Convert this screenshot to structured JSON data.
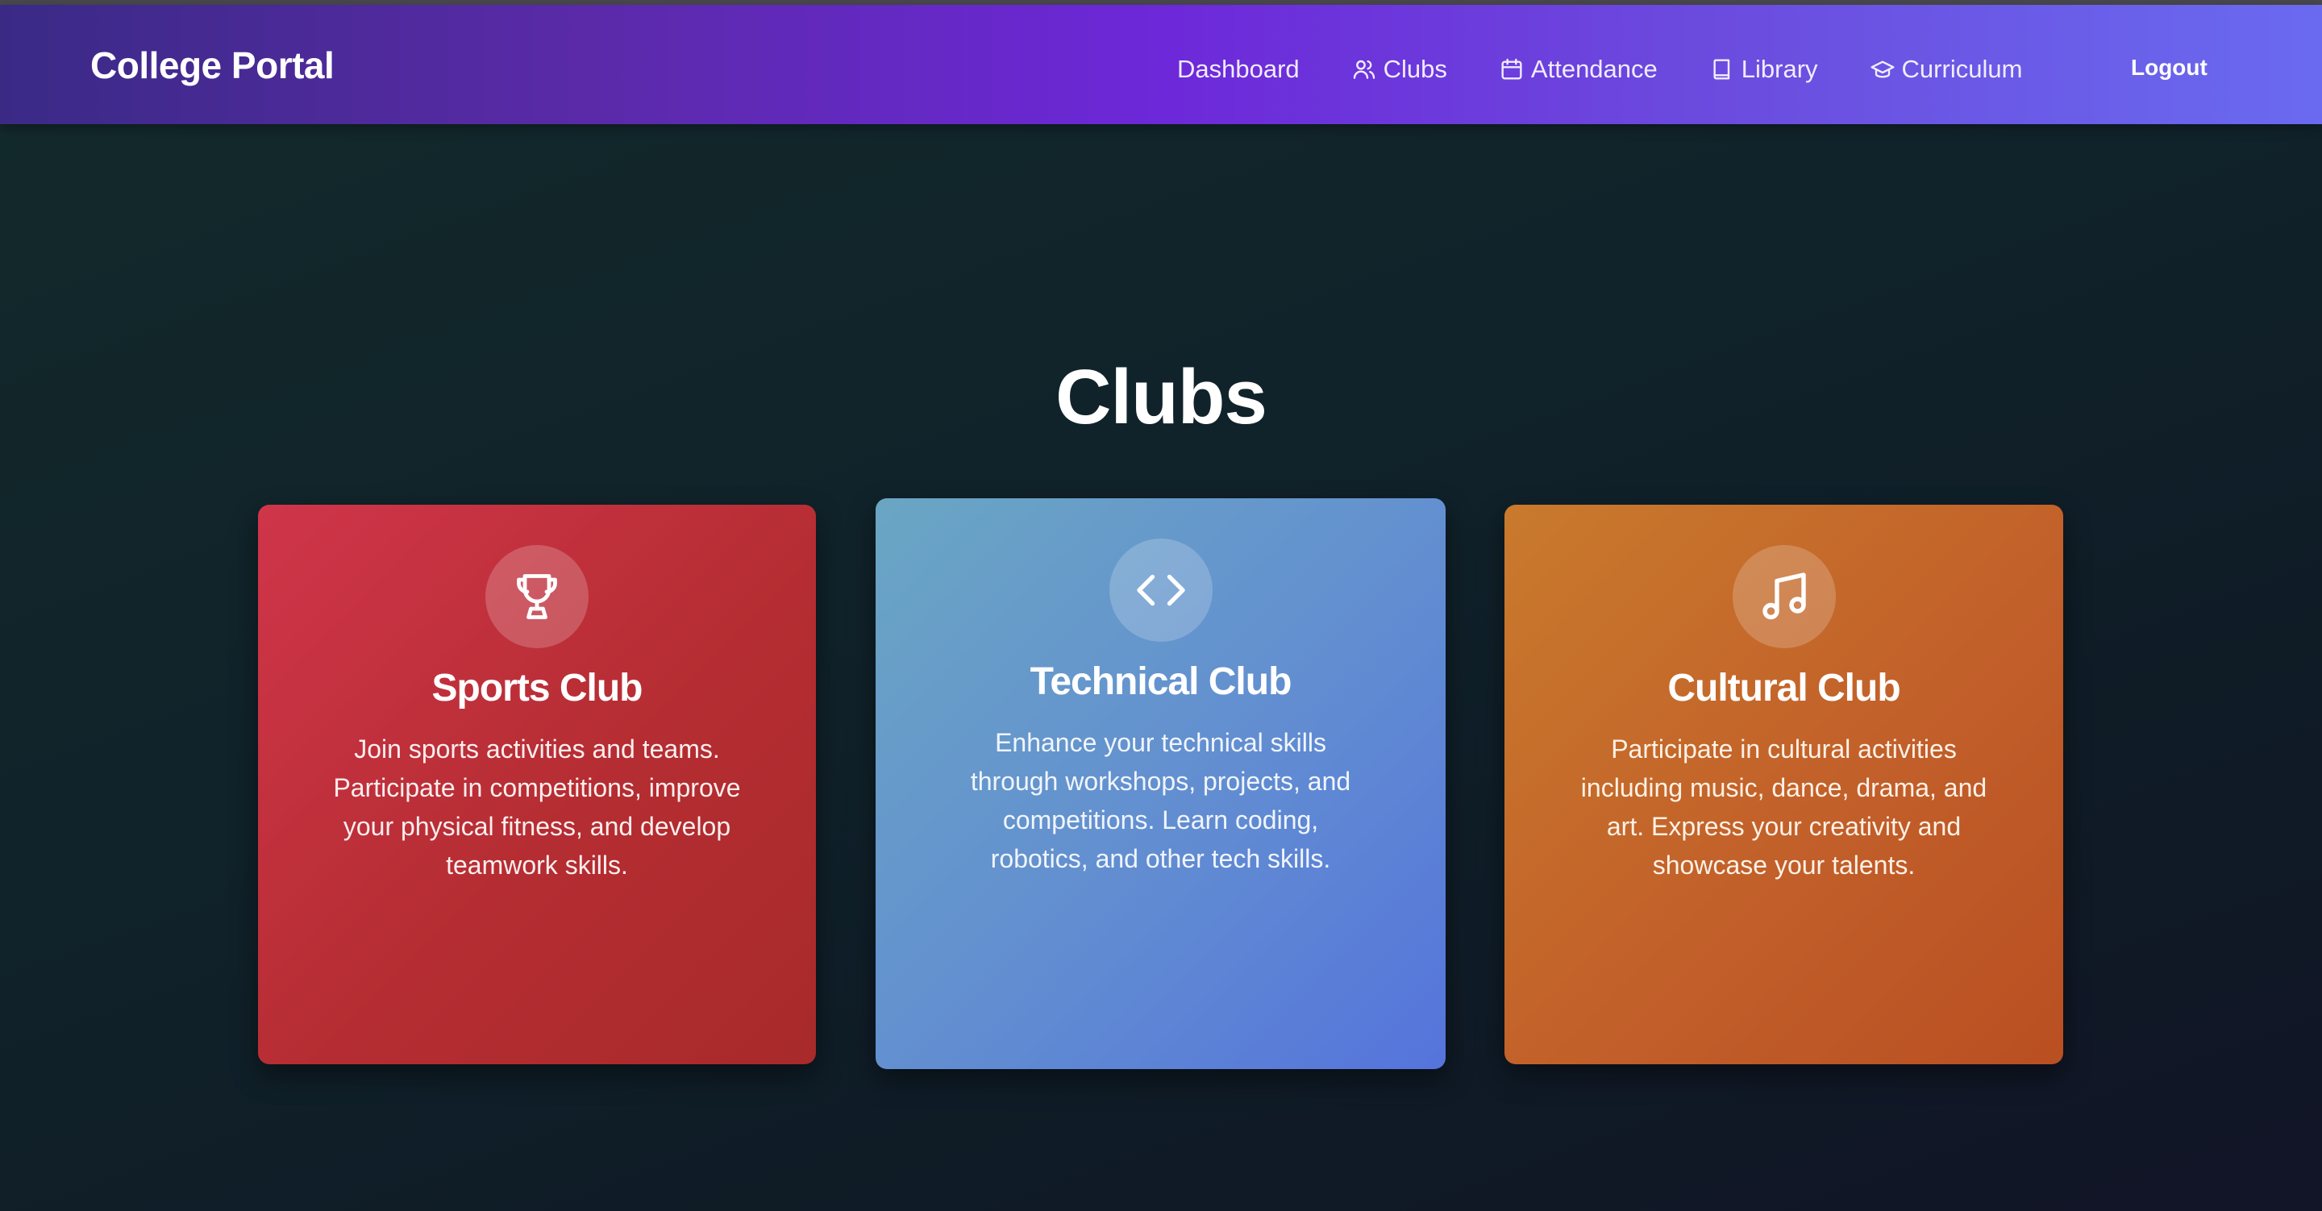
{
  "navbar": {
    "brand": "College Portal",
    "links": [
      {
        "label": "Dashboard",
        "icon": "none"
      },
      {
        "label": "Clubs",
        "icon": "users-icon"
      },
      {
        "label": "Attendance",
        "icon": "calendar-icon"
      },
      {
        "label": "Library",
        "icon": "book-icon"
      },
      {
        "label": "Curriculum",
        "icon": "graduation-cap-icon"
      }
    ],
    "logout": "Logout"
  },
  "page": {
    "title": "Clubs"
  },
  "cards": [
    {
      "title": "Sports Club",
      "icon": "trophy-icon",
      "description": "Join sports activities and teams. Participate in competitions, improve your physical fitness, and develop teamwork skills."
    },
    {
      "title": "Technical Club",
      "icon": "code-icon",
      "description": "Enhance your technical skills through workshops, projects, and competitions. Learn coding, robotics, and other tech skills."
    },
    {
      "title": "Cultural Club",
      "icon": "music-icon",
      "description": "Participate in cultural activities including music, dance, drama, and art. Express your creativity and showcase your talents."
    }
  ],
  "colors": {
    "navbar_start": "#3a2a86",
    "navbar_mid": "#6d28d9",
    "navbar_end": "#6a6af0",
    "sports": "#c0303c",
    "technical": "#6390d0",
    "cultural": "#c2602a"
  }
}
